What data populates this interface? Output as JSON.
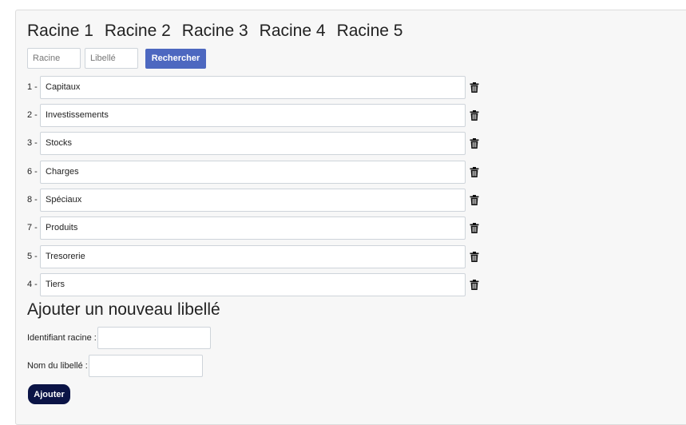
{
  "tabs": [
    "Racine 1",
    "Racine 2",
    "Racine 3",
    "Racine 4",
    "Racine 5"
  ],
  "search": {
    "racine_placeholder": "Racine",
    "libelle_placeholder": "Libellé",
    "button_label": "Rechercher"
  },
  "items": [
    {
      "num": "1 -",
      "value": "Capitaux"
    },
    {
      "num": "2 -",
      "value": "Investissements"
    },
    {
      "num": "3 -",
      "value": "Stocks"
    },
    {
      "num": "6 -",
      "value": "Charges"
    },
    {
      "num": "8 -",
      "value": "Spéciaux"
    },
    {
      "num": "7 -",
      "value": "Produits"
    },
    {
      "num": "5 -",
      "value": "Tresorerie"
    },
    {
      "num": "4 -",
      "value": "Tiers"
    }
  ],
  "add_form": {
    "title": "Ajouter un nouveau libellé",
    "racine_label": "Identifiant racine :",
    "racine_value": "",
    "nom_label": "Nom du libellé :",
    "nom_value": "",
    "button_label": "Ajouter"
  },
  "icons": {
    "delete": "trash-icon"
  },
  "colors": {
    "search_button": "#4d68c0",
    "add_button": "#0b1446"
  }
}
